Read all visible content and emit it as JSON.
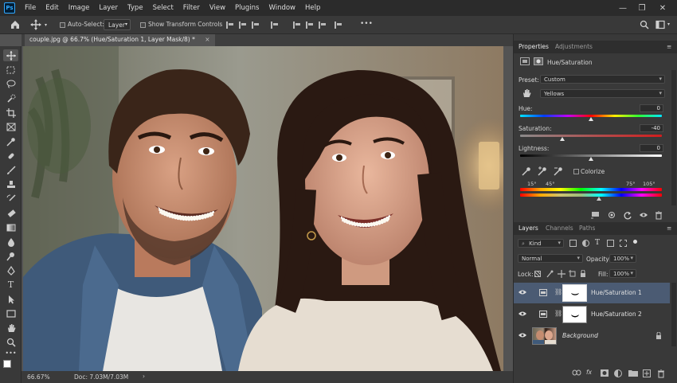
{
  "app": {
    "logo": "Ps"
  },
  "menu": [
    "File",
    "Edit",
    "Image",
    "Layer",
    "Type",
    "Select",
    "Filter",
    "View",
    "Plugins",
    "Window",
    "Help"
  ],
  "window_controls": {
    "minimize": "—",
    "restore": "❐",
    "close": "✕"
  },
  "options_bar": {
    "auto_select_label": "Auto-Select:",
    "auto_select_target": "Layer",
    "transform_controls_label": "Show Transform Controls",
    "more": "•••"
  },
  "document": {
    "tab_title": "couple.jpg @ 66.7% (Hue/Saturation 1, Layer Mask/8) *",
    "tab_close": "×",
    "zoom": "66.67%",
    "doc_size": "Doc: 7.03M/7.03M",
    "status_arrow": "›"
  },
  "properties": {
    "tab_active": "Properties",
    "tab_inactive": "Adjustments",
    "adjustment_name": "Hue/Saturation",
    "preset_label": "Preset:",
    "preset_value": "Custom",
    "channel_value": "Yellows",
    "hue_label": "Hue:",
    "hue_value": "0",
    "saturation_label": "Saturation:",
    "saturation_value": "-40",
    "lightness_label": "Lightness:",
    "lightness_value": "0",
    "colorize_label": "Colorize",
    "range_labels": {
      "a": "15°",
      "b": "45°",
      "c": "75°",
      "d": "105°"
    },
    "slider_levels": {
      "hue": 0.5,
      "saturation": 0.3,
      "lightness": 0.5
    }
  },
  "layers_panel": {
    "tabs": [
      "Layers",
      "Channels",
      "Paths"
    ],
    "filter_kind": "Kind",
    "blend_mode": "Normal",
    "opacity_label": "Opacity:",
    "opacity_value": "100%",
    "lock_label": "Lock:",
    "fill_label": "Fill:",
    "fill_value": "100%",
    "layers": [
      {
        "name": "Hue/Saturation 1",
        "selected": true
      },
      {
        "name": "Hue/Saturation 2",
        "selected": false
      },
      {
        "name": "Background",
        "selected": false
      }
    ]
  },
  "colors": {
    "menubar_bg": "#2b2b2b",
    "panel_bg": "#393939",
    "selection": "#4b5b73",
    "selection_marquee": "#ffffff"
  }
}
